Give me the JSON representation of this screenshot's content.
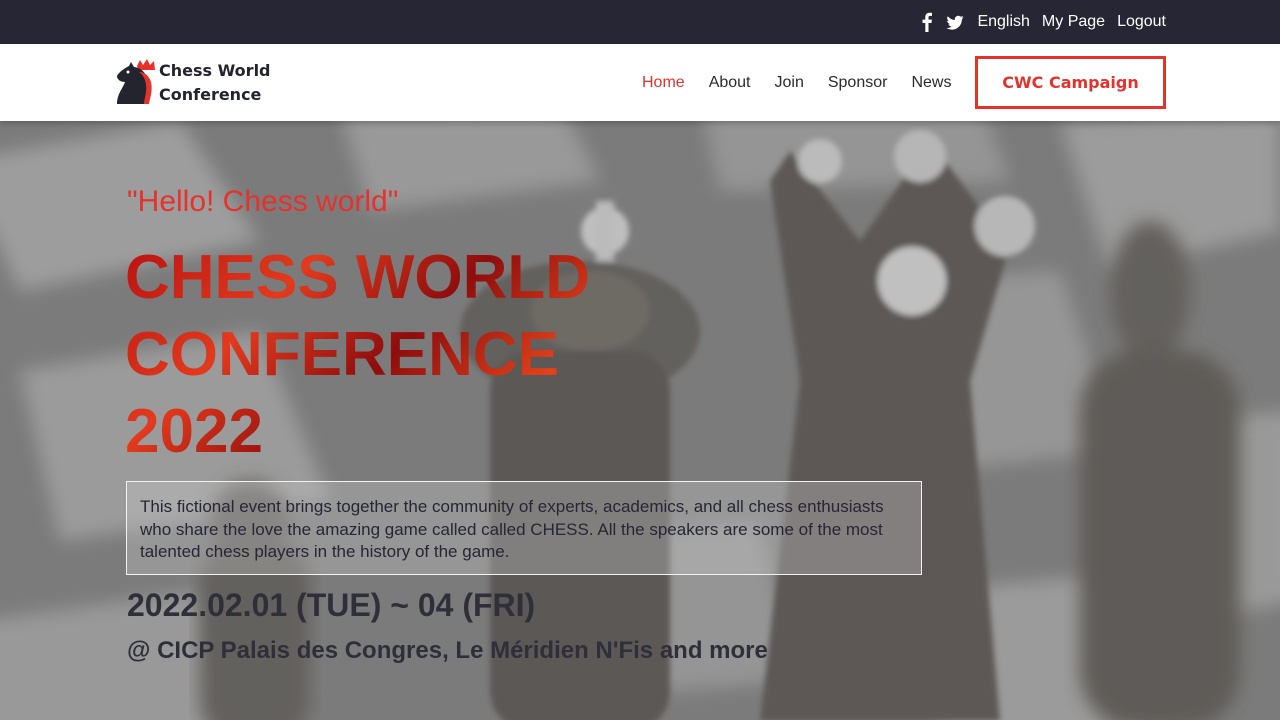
{
  "topbar": {
    "social": [
      {
        "icon": "facebook-icon"
      },
      {
        "icon": "twitter-icon"
      }
    ],
    "links": [
      "English",
      "My Page",
      "Logout"
    ]
  },
  "header": {
    "logo_line1": "Chess World",
    "logo_line2": "Conference",
    "nav": [
      "Home",
      "About",
      "Join",
      "Sponsor",
      "News"
    ],
    "active_nav": "Home",
    "cta_label": "CWC Campaign"
  },
  "hero": {
    "tagline": "\"Hello! Chess world\"",
    "title_lines": [
      "CHESS WORLD",
      "CONFERENCE",
      "2022"
    ],
    "description": "This fictional event brings together the community of experts, academics, and all chess enthusiasts who share the love the amazing game called called CHESS. All the speakers are some of the most talented chess players in the history of the game.",
    "dates": "2022.02.01 (TUE) ~ 04 (FRI)",
    "venue": "@ CICP Palais des Congres, Le Méridien N'Fis and more"
  },
  "colors": {
    "accent": "#e5322d",
    "topbar": "#262634",
    "text_dark": "#2f2f3a"
  }
}
